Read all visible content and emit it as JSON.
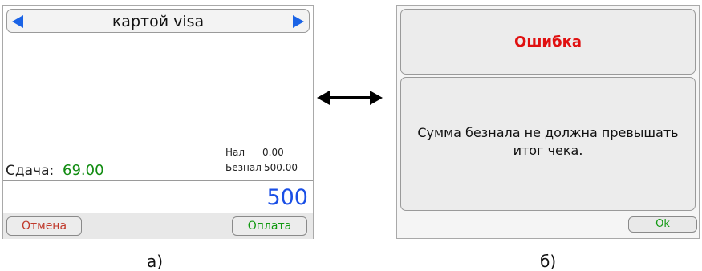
{
  "screen_a": {
    "title": "картой visa",
    "change_label": "Сдача:",
    "change_value": "69.00",
    "cash_label": "Нал",
    "cash_value": "0.00",
    "card_label": "Безнал",
    "card_value": "500.00",
    "total": "500",
    "cancel_label": "Отмена",
    "pay_label": "Оплата"
  },
  "screen_b": {
    "error_title": "Ошибка",
    "error_message_line1": "Сумма безнала не должна превышать",
    "error_message_line2": "итог чека.",
    "ok_label": "Ok"
  },
  "captions": {
    "a": "а)",
    "b": "б)"
  },
  "colors": {
    "arrow_blue": "#1a63e6",
    "change_green": "#118c11",
    "total_blue": "#1a4fe6",
    "cancel_red": "#c0392b",
    "error_red": "#e01010"
  },
  "icons": {
    "prev": "left-triangle-icon",
    "next": "right-triangle-icon",
    "transition": "double-arrow-icon"
  }
}
